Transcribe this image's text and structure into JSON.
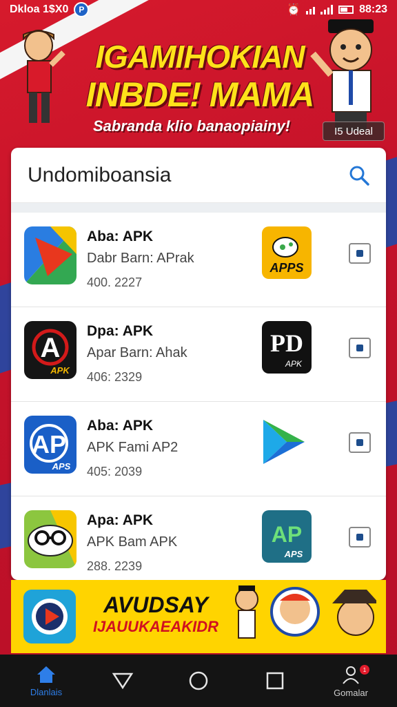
{
  "status_bar": {
    "time_left": "Dkloa 1$X0",
    "badge_icon": "p-badge-icon",
    "time_right": "88:23"
  },
  "banner": {
    "title_line1": "IGAMIHOKIAN",
    "title_line2": "INBDE! MAMA",
    "subtitle": "Sabranda klio banaopiainy!",
    "detail_button": "I5 Udeal"
  },
  "search": {
    "value": "Undomiboansia",
    "icon": "search-icon"
  },
  "list": [
    {
      "title": "Aba: APK",
      "subtitle": "Dabr Barn: APrak",
      "date": "400. 2227",
      "icon": "red-arrow-app-icon",
      "logo_text": "APPS",
      "logo": "chat-apps-logo"
    },
    {
      "title": "Dpa: APK",
      "subtitle": "Apar Barn: Ahak",
      "date": "406: 2329",
      "icon": "black-a-app-icon",
      "logo_text": "APK",
      "logo": "black-apk-logo",
      "icon_text": "APK"
    },
    {
      "title": "Aba: APK",
      "subtitle": "APK Fami AP2",
      "date": "405: 2039",
      "icon": "blue-ap-app-icon",
      "icon_text": "APS",
      "logo": "play-triangle-logo"
    },
    {
      "title": "Apa: APK",
      "subtitle": "APK Bam APK",
      "date": "288. 2239",
      "icon": "glasses-app-icon",
      "logo_text": "APS",
      "logo": "green-ap-logo"
    }
  ],
  "ad": {
    "line1": "AVUDSAY",
    "line2": "IJAUUKAEAKIDR"
  },
  "nav": {
    "home_label": "Dlanlais",
    "profile_label": "Gomalar",
    "profile_badge": "1"
  }
}
